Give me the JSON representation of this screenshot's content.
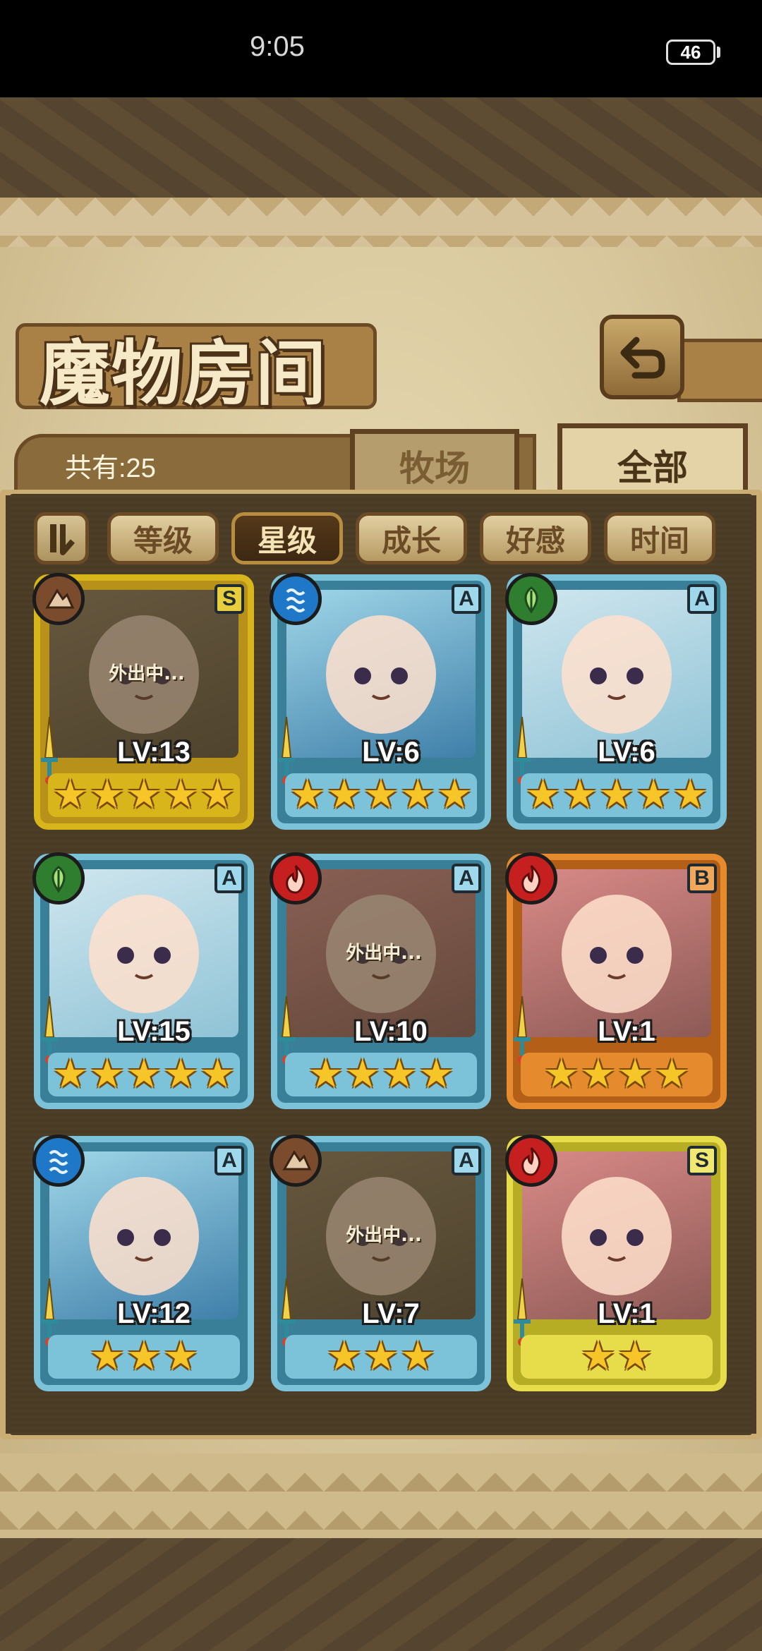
{
  "status_bar": {
    "time": "9:05",
    "battery": "46"
  },
  "header": {
    "title": "魔物房间"
  },
  "summary": {
    "count_label": "共有:25"
  },
  "tabs": [
    {
      "label": "牧场",
      "active": false
    },
    {
      "label": "全部",
      "active": true
    }
  ],
  "sort": {
    "toggle_icon": "sort-order-icon",
    "options": [
      {
        "label": "等级",
        "active": false
      },
      {
        "label": "星级",
        "active": true
      },
      {
        "label": "成长",
        "active": false
      },
      {
        "label": "好感",
        "active": false
      },
      {
        "label": "时间",
        "active": false
      }
    ]
  },
  "monsters": [
    {
      "level": "LV:13",
      "rank": "S",
      "element": "earth",
      "stars": "★★★★★",
      "frame": "gold",
      "away": "外出中..."
    },
    {
      "level": "LV:6",
      "rank": "A",
      "element": "water",
      "stars": "★★★★★",
      "frame": "blue",
      "away": ""
    },
    {
      "level": "LV:6",
      "rank": "A",
      "element": "wood",
      "stars": "★★★★★",
      "frame": "blue",
      "away": ""
    },
    {
      "level": "LV:15",
      "rank": "A",
      "element": "wood",
      "stars": "★★★★★",
      "frame": "blue",
      "away": ""
    },
    {
      "level": "LV:10",
      "rank": "A",
      "element": "fire",
      "stars": "★★★★",
      "frame": "blue",
      "away": "外出中..."
    },
    {
      "level": "LV:1",
      "rank": "B",
      "element": "fire",
      "stars": "★★★★",
      "frame": "orange",
      "away": ""
    },
    {
      "level": "LV:12",
      "rank": "A",
      "element": "water",
      "stars": "★★★",
      "frame": "blue",
      "away": ""
    },
    {
      "level": "LV:7",
      "rank": "A",
      "element": "earth",
      "stars": "★★★",
      "frame": "blue",
      "away": "外出中..."
    },
    {
      "level": "LV:1",
      "rank": "S",
      "element": "fire",
      "stars": "★★",
      "frame": "yellow",
      "away": ""
    }
  ],
  "colors": {
    "earth": "#7a4b2c",
    "water": "#1f77c7",
    "wood": "#2f7d2f",
    "fire": "#c51f1f",
    "gold": "#d9b51c",
    "blue": "#7cc2d9",
    "orange": "#e68a2e",
    "yellow": "#e7dd4a"
  }
}
